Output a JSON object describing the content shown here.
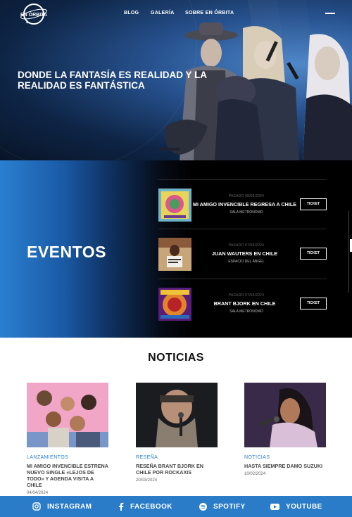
{
  "brand": {
    "logo_text": "EN ÓRBITA"
  },
  "nav": {
    "items": [
      "BLOG",
      "GALERÍA",
      "SOBRE EN ÓRBITA"
    ]
  },
  "hero": {
    "title": "DONDE LA FANTASÍA ES REALIDAD Y LA REALIDAD ES FANTÁSTICA"
  },
  "events": {
    "title": "EVENTOS",
    "items": [
      {
        "date": "PASADO 08/06/2024",
        "name": "MI AMIGO INVENCIBLE REGRESA A CHILE",
        "venue": "SALA METRÓNOMO",
        "ticket": "TICKET"
      },
      {
        "date": "PASADO 07/06/2024",
        "name": "JUAN WAUTERS EN CHILE",
        "venue": "ESPACIO DEL ÁNGEL",
        "ticket": "TICKET"
      },
      {
        "date": "PASADO 07/03/2024",
        "name": "BRANT BJORK EN CHILE",
        "venue": "SALA METRÓNOMO",
        "ticket": "TICKET"
      }
    ]
  },
  "news": {
    "title": "NOTICIAS",
    "items": [
      {
        "category": "LANZAMIENTOS",
        "headline": "MI AMIGO INVENCIBLE ESTRENA NUEVO SINGLE «LEJOS DE TODO» Y AGENDA VISITA A CHILE",
        "date": "04/04/2024"
      },
      {
        "category": "RESEÑA",
        "headline": "RESEÑA BRANT BJORK EN CHILE POR ROCKAXIS",
        "date": "20/03/2024"
      },
      {
        "category": "NOTICIAS",
        "headline": "HASTA SIEMPRE DAMO SUZUKI",
        "date": "10/02/2024"
      }
    ]
  },
  "social": {
    "items": [
      {
        "label": "INSTAGRAM",
        "icon": "instagram-icon"
      },
      {
        "label": "FACEBOOK",
        "icon": "facebook-icon"
      },
      {
        "label": "SPOTIFY",
        "icon": "spotify-icon"
      },
      {
        "label": "YOUTUBE",
        "icon": "youtube-icon"
      }
    ]
  },
  "colors": {
    "accent": "#2a7cc8",
    "dark": "#000000"
  }
}
